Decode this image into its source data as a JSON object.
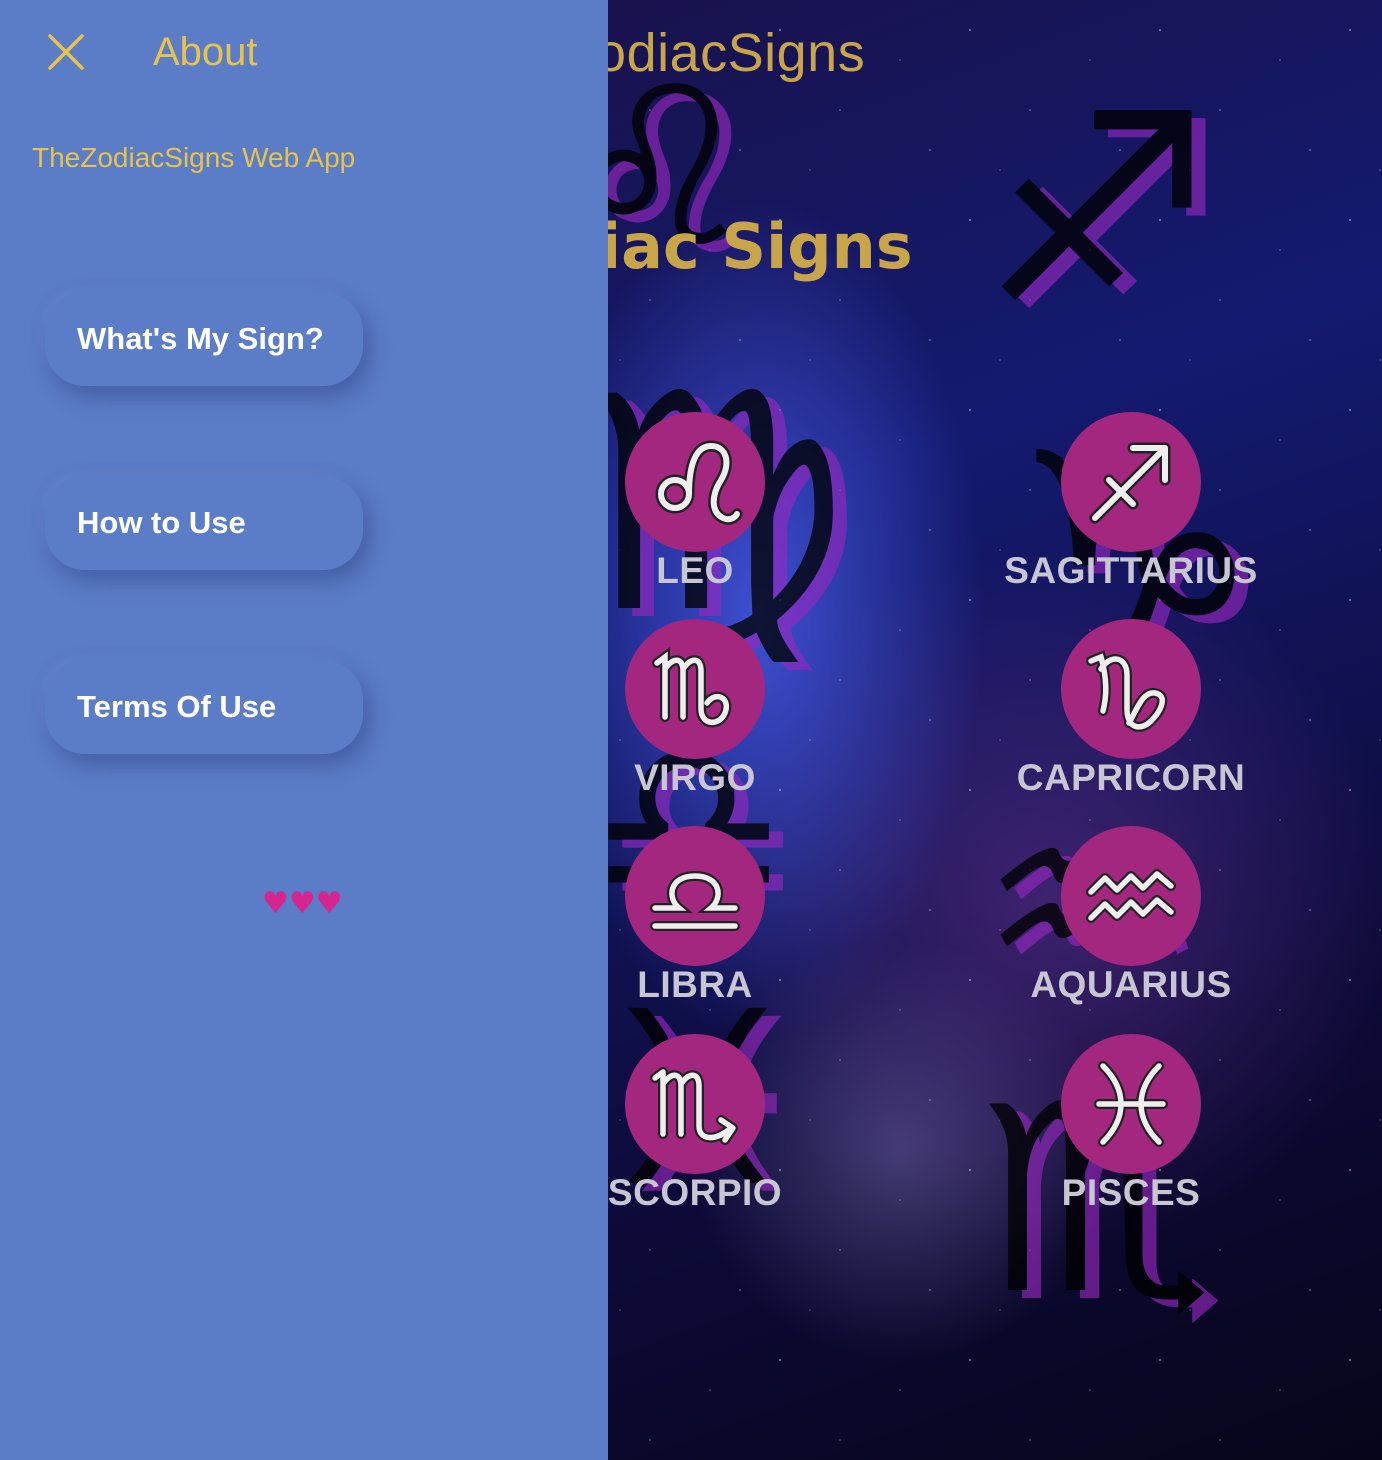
{
  "background": {
    "app_title": "TheZodiacSigns",
    "page_heading": "Zodiac Signs",
    "signs": [
      {
        "name": "LEO",
        "icon": "leo-icon"
      },
      {
        "name": "SAGITTARIUS",
        "icon": "sagittarius-icon"
      },
      {
        "name": "VIRGO",
        "icon": "virgo-icon"
      },
      {
        "name": "CAPRICORN",
        "icon": "capricorn-icon"
      },
      {
        "name": "LIBRA",
        "icon": "libra-icon"
      },
      {
        "name": "AQUARIUS",
        "icon": "aquarius-icon"
      },
      {
        "name": "SCORPIO",
        "icon": "scorpio-icon"
      },
      {
        "name": "PISCES",
        "icon": "pisces-icon"
      }
    ]
  },
  "drawer": {
    "title": "About",
    "subtitle": "TheZodiacSigns Web App",
    "close_icon": "close-icon",
    "menu": [
      {
        "label": "What's My Sign?"
      },
      {
        "label": "How to Use"
      },
      {
        "label": "Terms Of Use"
      }
    ],
    "hearts": "♥♥♥"
  },
  "colors": {
    "drawer_bg": "#5b7cc6",
    "accent_gold": "#e8c34b",
    "sign_circle": "#a3277f",
    "heart": "#d6258f"
  }
}
